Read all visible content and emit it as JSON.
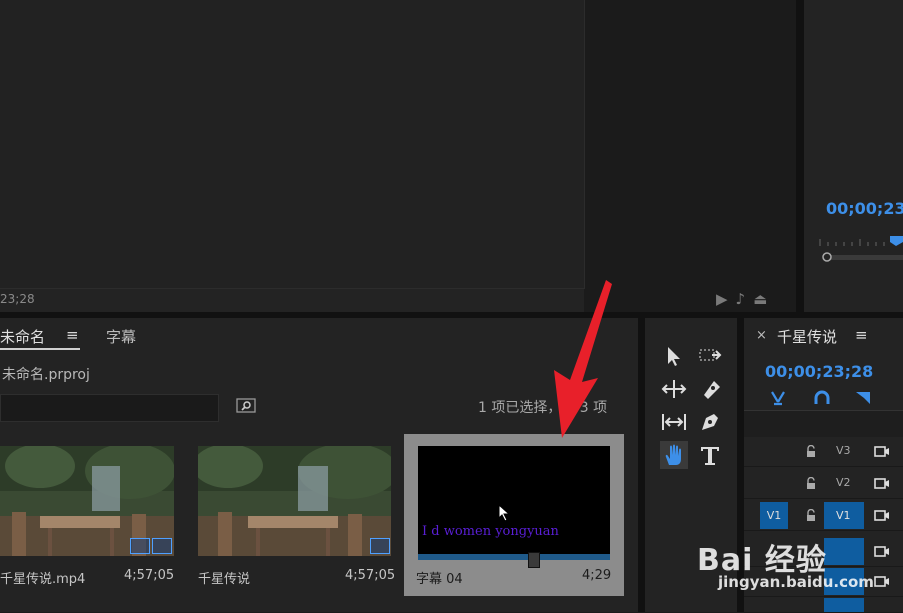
{
  "program_monitor": {
    "timecode": "23;28"
  },
  "source_monitor": {
    "timecode": "00;00;23;"
  },
  "project_panel": {
    "tabs": [
      {
        "label": "未命名",
        "active": true
      },
      {
        "label": "字幕",
        "active": false
      }
    ],
    "menu_icon": "≡",
    "filename": "未命名.prproj",
    "search": {
      "value": "",
      "placeholder": ""
    },
    "selection_info": "1 项已选择，共 3 项",
    "items": [
      {
        "name": "千星传说.mp4",
        "duration": "4;57;05"
      },
      {
        "name": "千星传说",
        "duration": "4;57;05"
      },
      {
        "name": "字幕 04",
        "duration": "4;29",
        "selected": true,
        "caption_text": "I d women yongyuan"
      }
    ]
  },
  "timeline": {
    "close": "×",
    "title": "千星传说",
    "menu_icon": "≡",
    "timecode": "00;00;23;28",
    "tracks": [
      {
        "name": "V3",
        "source": "",
        "targeted": false
      },
      {
        "name": "V2",
        "source": "",
        "targeted": false
      },
      {
        "name": "V1",
        "source": "V1",
        "targeted": true
      },
      {
        "name": "",
        "source": "",
        "targeted": true
      },
      {
        "name": "",
        "source": "",
        "targeted": true
      },
      {
        "name": "",
        "source": "",
        "targeted": true
      }
    ]
  },
  "watermark": {
    "logo": "Bai 经验",
    "url": "jingyan.baidu.com"
  },
  "colors": {
    "accent": "#3d8fe8",
    "annotation_arrow": "#e8202a",
    "selected_card": "#8c8c8c"
  }
}
